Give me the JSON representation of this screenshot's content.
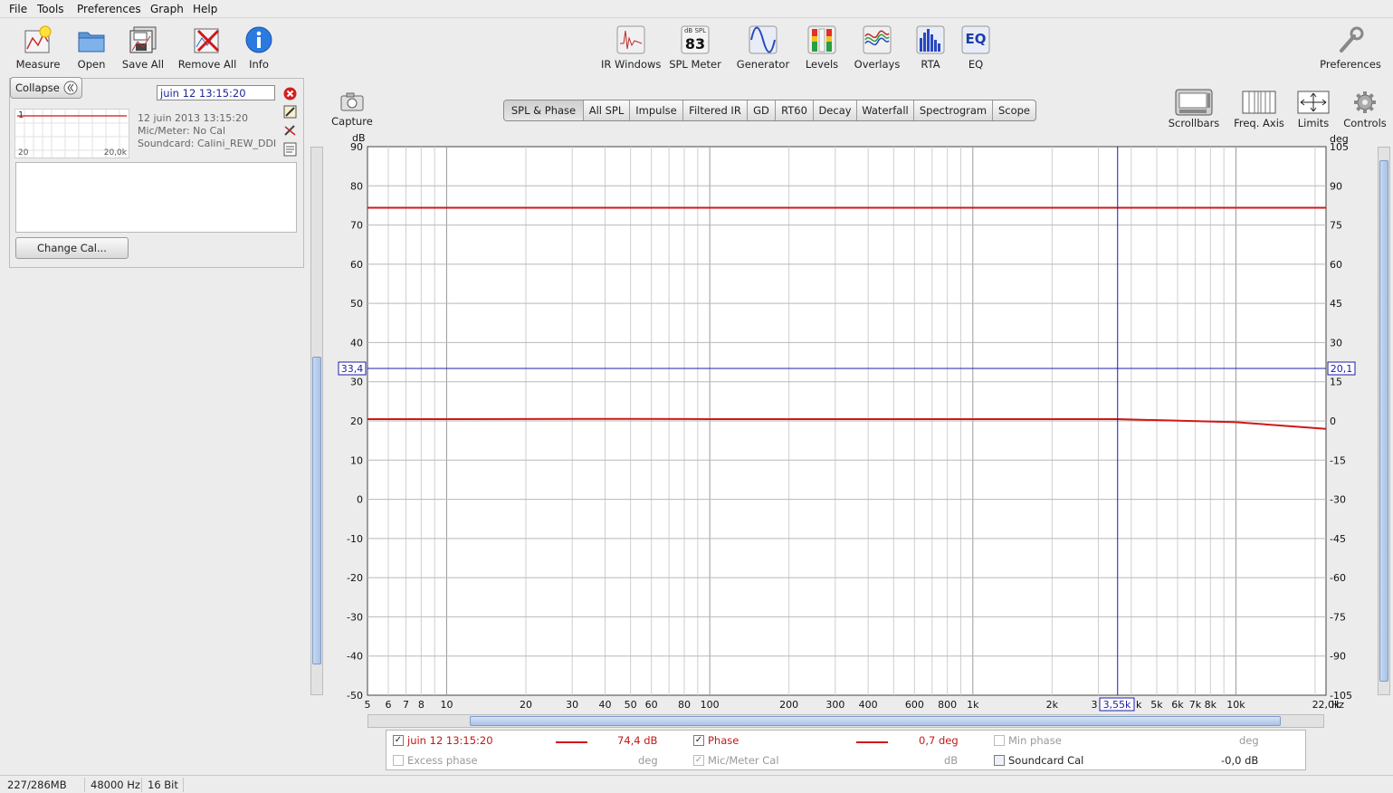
{
  "menu": [
    "File",
    "Tools",
    "Preferences",
    "Graph",
    "Help"
  ],
  "toolbar_left": [
    {
      "label": "Measure",
      "icon": "measure-icon"
    },
    {
      "label": "Open",
      "icon": "folder-open-icon"
    },
    {
      "label": "Save All",
      "icon": "save-all-icon"
    },
    {
      "label": "Remove All",
      "icon": "remove-all-icon"
    },
    {
      "label": "Info",
      "icon": "info-icon"
    }
  ],
  "toolbar_center": [
    {
      "label": "IR Windows",
      "icon": "ir-windows-icon"
    },
    {
      "label": "SPL Meter",
      "icon": "spl-meter-icon",
      "icon_top": "dB SPL",
      "icon_value": "83"
    },
    {
      "label": "Generator",
      "icon": "generator-icon"
    },
    {
      "label": "Levels",
      "icon": "levels-icon"
    },
    {
      "label": "Overlays",
      "icon": "overlays-icon"
    },
    {
      "label": "RTA",
      "icon": "rta-icon"
    },
    {
      "label": "EQ",
      "icon": "eq-icon",
      "icon_text": "EQ"
    }
  ],
  "toolbar_right": {
    "label": "Preferences",
    "icon": "wrench-icon"
  },
  "left_panel": {
    "collapse_label": "Collapse",
    "measurement_name": "juin 12 13:15:20",
    "thumb_index": "1",
    "thumb_xmin": "20",
    "thumb_xmax": "20,0k",
    "info": [
      "12 juin 2013 13:15:20",
      "Mic/Meter: No Cal",
      "Soundcard: Calini_REW_DDI"
    ],
    "change_cal_label": "Change Cal..."
  },
  "capture": {
    "label": "Capture",
    "icon": "camera-icon"
  },
  "view_tabs": [
    "SPL & Phase",
    "All SPL",
    "Impulse",
    "Filtered IR",
    "GD",
    "RT60",
    "Decay",
    "Waterfall",
    "Spectrogram",
    "Scope"
  ],
  "active_tab": "SPL & Phase",
  "graph_controls": [
    {
      "label": "Scrollbars",
      "icon": "scrollbars-icon"
    },
    {
      "label": "Freq. Axis",
      "icon": "freq-axis-icon"
    },
    {
      "label": "Limits",
      "icon": "limits-icon"
    },
    {
      "label": "Controls",
      "icon": "gear-icon"
    }
  ],
  "graph": {
    "left_unit": "dB",
    "right_unit": "deg",
    "x_unit": "Hz",
    "left_ticks": [
      "90",
      "80",
      "70",
      "60",
      "50",
      "40",
      "30",
      "20",
      "10",
      "0",
      "-10",
      "-20",
      "-30",
      "-40",
      "-50"
    ],
    "right_ticks": [
      "105",
      "90",
      "75",
      "60",
      "45",
      "30",
      "15",
      "0",
      "-15",
      "-30",
      "-45",
      "-60",
      "-75",
      "-90",
      "-105"
    ],
    "x_ticks": [
      "5",
      "6",
      "7",
      "8",
      "10",
      "20",
      "30",
      "40",
      "50",
      "60",
      "80",
      "100",
      "200",
      "300",
      "400",
      "600",
      "800",
      "1k",
      "2k",
      "3k",
      "5k",
      "6k",
      "7k",
      "8k",
      "10k",
      "22,0k"
    ],
    "cursor_left_value": "33,4",
    "cursor_right_value": "20,1",
    "cursor_freq": "3,55k",
    "spl_color": "#d01818",
    "phase_color": "#d01818",
    "cursor_color": "#1c1cb0"
  },
  "chart_data": {
    "type": "line",
    "xlabel": "Hz",
    "ylabel": "dB",
    "y2label": "deg",
    "x_scale": "log",
    "xlim": [
      5,
      22000
    ],
    "ylim": [
      -50,
      90
    ],
    "y2lim": [
      -105,
      105
    ],
    "grid": true,
    "series": [
      {
        "name": "juin 12 13:15:20",
        "axis": "dB",
        "x": [
          5,
          10,
          50,
          100,
          1000,
          3550,
          10000,
          22000
        ],
        "values": [
          74.4,
          74.4,
          74.4,
          74.4,
          74.4,
          74.4,
          74.4,
          74.4
        ]
      },
      {
        "name": "Phase",
        "axis": "deg",
        "x": [
          5,
          10,
          50,
          100,
          1000,
          3550,
          10000,
          22000
        ],
        "values": [
          0.7,
          0.7,
          0.8,
          0.7,
          0.7,
          0.7,
          -0.5,
          -3
        ]
      }
    ],
    "cursor": {
      "x": 3550,
      "y": 33.4,
      "y2": 20.1
    }
  },
  "legend": {
    "row1": [
      {
        "checked": true,
        "name": "juin 12 13:15:20",
        "value": "74,4 dB",
        "color": "#d01818"
      },
      {
        "checked": true,
        "name": "Phase",
        "value": "0,7 deg",
        "color": "#d01818"
      },
      {
        "checked": false,
        "name": "Min phase",
        "value": "deg"
      }
    ],
    "row2": [
      {
        "checked": false,
        "name": "Excess phase",
        "value": "deg"
      },
      {
        "checked": true,
        "name": "Mic/Meter Cal",
        "value": "dB"
      },
      {
        "checked": false,
        "name": "Soundcard Cal",
        "value": "-0,0 dB"
      }
    ]
  },
  "status": [
    "227/286MB",
    "48000 Hz",
    "16 Bit"
  ]
}
